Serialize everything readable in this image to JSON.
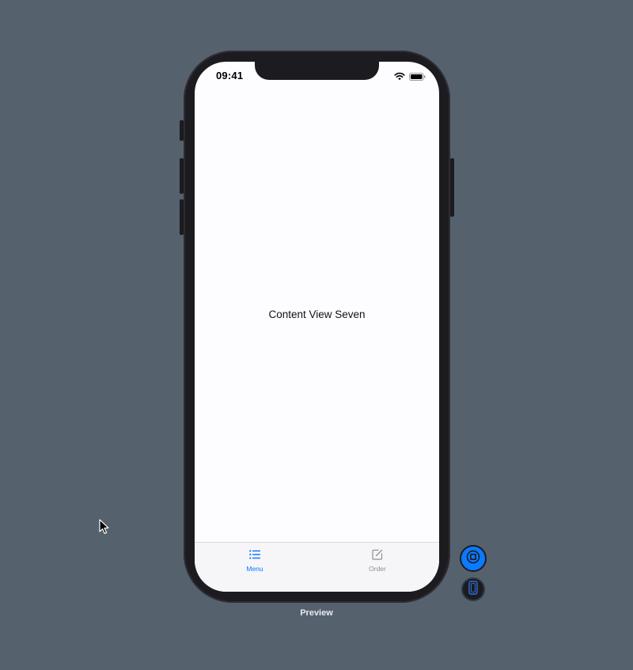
{
  "status_bar": {
    "time": "09:41",
    "wifi_icon": "wifi-icon",
    "battery_icon": "battery-icon"
  },
  "content": {
    "text": "Content View Seven"
  },
  "tab_bar": {
    "active_color": "#0a7aff",
    "inactive_color": "#8e8e93",
    "tabs": [
      {
        "label": "Menu",
        "icon": "list-icon",
        "selected": true
      },
      {
        "label": "Order",
        "icon": "compose-icon",
        "selected": false
      }
    ]
  },
  "preview": {
    "label": "Preview",
    "live_button_icon": "stop-icon",
    "device_button_icon": "device-icon",
    "accent_color": "#0a7aff"
  },
  "colors": {
    "background": "#56616e",
    "device_frame": "#1c1b1f",
    "screen": "#fdfcff"
  }
}
